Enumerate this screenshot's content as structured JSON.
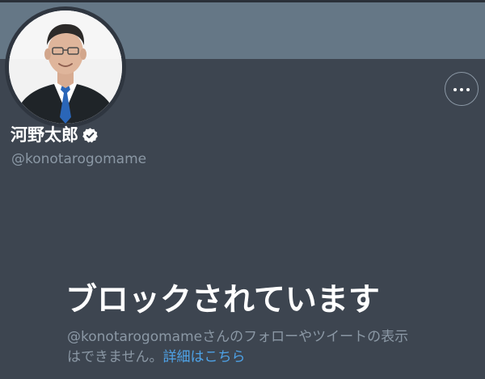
{
  "profile": {
    "display_name": "河野太郎",
    "handle": "@konotarogomame",
    "verified": true
  },
  "icons": {
    "verified": "verified-badge-icon",
    "more": "more-options-icon"
  },
  "blocked": {
    "title": "ブロックされています",
    "description_line1": "@konotarogomameさんのフォローやツイートの表示",
    "description_line2": "はできません。",
    "learn_more_link": "詳細はこちら"
  },
  "colors": {
    "banner": "#657786",
    "background": "#3d4550",
    "secondary_text": "#8b98a5",
    "link": "#4ea3e8"
  }
}
